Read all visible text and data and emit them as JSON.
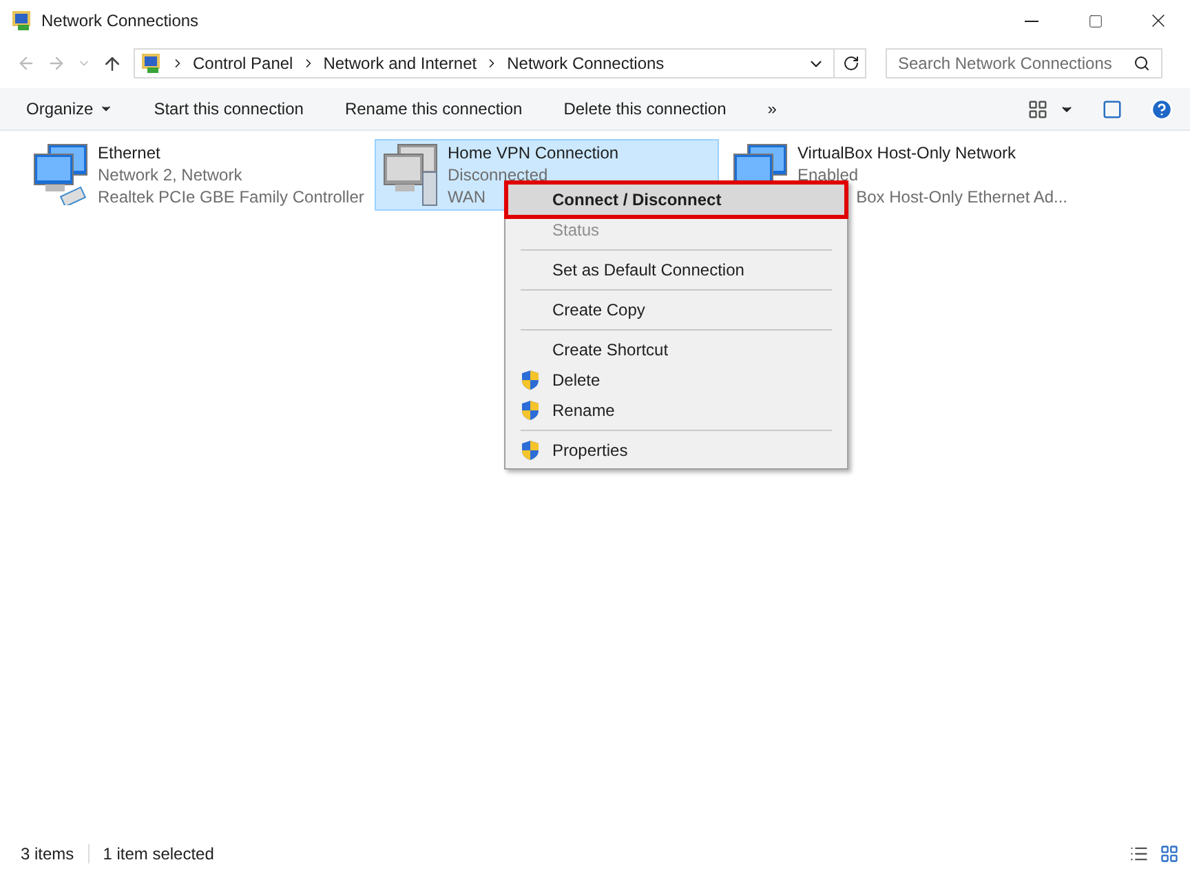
{
  "window": {
    "title": "Network Connections"
  },
  "address": {
    "crumbs": [
      "Control Panel",
      "Network and Internet",
      "Network Connections"
    ]
  },
  "search": {
    "placeholder": "Search Network Connections"
  },
  "toolbar": {
    "items": [
      {
        "label": "Organize",
        "kind": "menu"
      },
      {
        "label": "Start this connection",
        "kind": "plain"
      },
      {
        "label": "Rename this connection",
        "kind": "plain"
      },
      {
        "label": "Delete this connection",
        "kind": "plain"
      },
      {
        "label": "»",
        "kind": "plain"
      }
    ]
  },
  "connections": [
    {
      "name": "Ethernet",
      "status": "Network  2, Network",
      "device": "Realtek PCIe GBE Family Controller",
      "kind": "ethernet",
      "selected": false
    },
    {
      "name": "Home VPN Connection",
      "status": "Disconnected",
      "device": "WAN",
      "kind": "vpn",
      "selected": true
    },
    {
      "name": "VirtualBox Host-Only Network",
      "status": "Enabled",
      "device": "Box Host-Only Ethernet Ad...",
      "kind": "adapter",
      "selected": false,
      "device_cut_at_start": true
    }
  ],
  "context_menu": {
    "items": [
      {
        "kind": "item",
        "label": "Connect / Disconnect",
        "bold": true,
        "highlighted": true,
        "disabled": false,
        "shield": false
      },
      {
        "kind": "item",
        "label": "Status",
        "bold": false,
        "highlighted": false,
        "disabled": true,
        "shield": false
      },
      {
        "kind": "separator"
      },
      {
        "kind": "item",
        "label": "Set as Default Connection",
        "bold": false,
        "highlighted": false,
        "disabled": false,
        "shield": false
      },
      {
        "kind": "separator"
      },
      {
        "kind": "item",
        "label": "Create Copy",
        "bold": false,
        "highlighted": false,
        "disabled": false,
        "shield": false
      },
      {
        "kind": "separator"
      },
      {
        "kind": "item",
        "label": "Create Shortcut",
        "bold": false,
        "highlighted": false,
        "disabled": false,
        "shield": false
      },
      {
        "kind": "item",
        "label": "Delete",
        "bold": false,
        "highlighted": false,
        "disabled": false,
        "shield": true
      },
      {
        "kind": "item",
        "label": "Rename",
        "bold": false,
        "highlighted": false,
        "disabled": false,
        "shield": true
      },
      {
        "kind": "separator"
      },
      {
        "kind": "item",
        "label": "Properties",
        "bold": false,
        "highlighted": false,
        "disabled": false,
        "shield": true
      }
    ]
  },
  "status_bar": {
    "count": "3 items",
    "selection": "1 item selected"
  }
}
